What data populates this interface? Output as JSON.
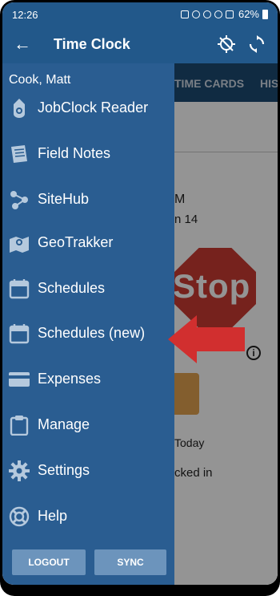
{
  "status_bar": {
    "time": "12:26",
    "battery": "62%"
  },
  "app_bar": {
    "back_icon": "back-arrow-icon",
    "title": "Time Clock",
    "gps_icon": "gps-off-icon",
    "sync_icon": "sync-icon"
  },
  "background": {
    "tabs": [
      "TIME CARDS",
      "HIS"
    ],
    "fragments": [
      "M",
      "n 14",
      "Today",
      "cked in"
    ],
    "stop_sign_text": "Stop"
  },
  "drawer": {
    "user_name": "Cook, Matt",
    "items": [
      {
        "label": "JobClock Reader",
        "icon": "jobclock-icon"
      },
      {
        "label": "Field Notes",
        "icon": "notes-icon"
      },
      {
        "label": "SiteHub",
        "icon": "share-icon"
      },
      {
        "label": "GeoTrakker",
        "icon": "map-icon"
      },
      {
        "label": "Schedules",
        "icon": "calendar-icon"
      },
      {
        "label": "Schedules (new)",
        "icon": "calendar-icon"
      },
      {
        "label": "Expenses",
        "icon": "credit-card-icon"
      },
      {
        "label": "Manage",
        "icon": "clipboard-icon"
      },
      {
        "label": "Settings",
        "icon": "gear-icon"
      },
      {
        "label": "Help",
        "icon": "lifebuoy-icon"
      }
    ],
    "logout_label": "LOGOUT",
    "sync_label": "SYNC"
  },
  "colors": {
    "drawer_bg": "#2a5d91",
    "app_bar": "#22588a",
    "button": "#6c94bc",
    "arrow": "#d12f2f"
  }
}
